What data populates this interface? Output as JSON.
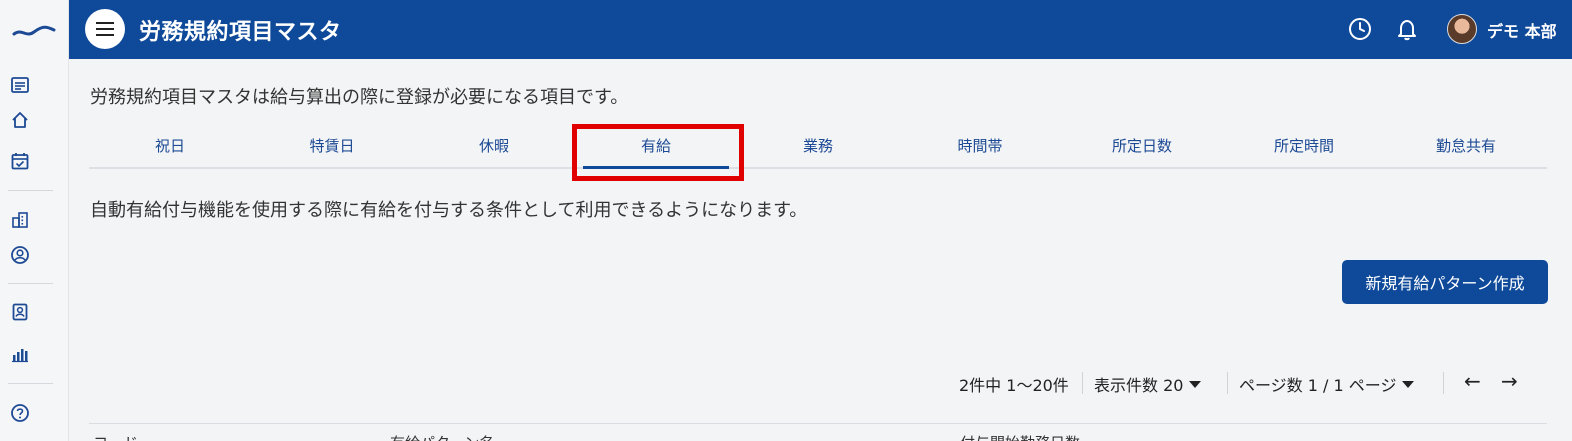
{
  "header": {
    "title": "労務規約項目マスタ",
    "user_name": "デモ 本部"
  },
  "intro": "労務規約項目マスタは給与算出の際に登録が必要になる項目です。",
  "tabs": [
    {
      "label": "祝日"
    },
    {
      "label": "特賃日"
    },
    {
      "label": "休暇"
    },
    {
      "label": "有給",
      "active": true
    },
    {
      "label": "業務"
    },
    {
      "label": "時間帯"
    },
    {
      "label": "所定日数"
    },
    {
      "label": "所定時間"
    },
    {
      "label": "勤怠共有"
    }
  ],
  "description": "自動有給付与機能を使用する際に有給を付与する条件として利用できるようになります。",
  "new_button": "新規有給パターン作成",
  "pager": {
    "count": "2件中 1〜20件",
    "per_page": "表示件数 20",
    "page": "ページ数 1 / 1 ページ",
    "prev": "←",
    "next": "→"
  },
  "table": {
    "columns": [
      "コード",
      "有給パターン名",
      "付与開始勤務日数"
    ]
  },
  "colors": {
    "brand": "#0f4a9a",
    "highlight": "#e00000"
  },
  "icons": {
    "sidebar": [
      "list-icon",
      "home-icon",
      "calendar-check-icon",
      "building-icon",
      "user-circle-icon",
      "id-badge-icon",
      "bar-chart-icon",
      "help-icon"
    ],
    "header": [
      "menu-icon",
      "clock-icon",
      "bell-icon"
    ]
  }
}
